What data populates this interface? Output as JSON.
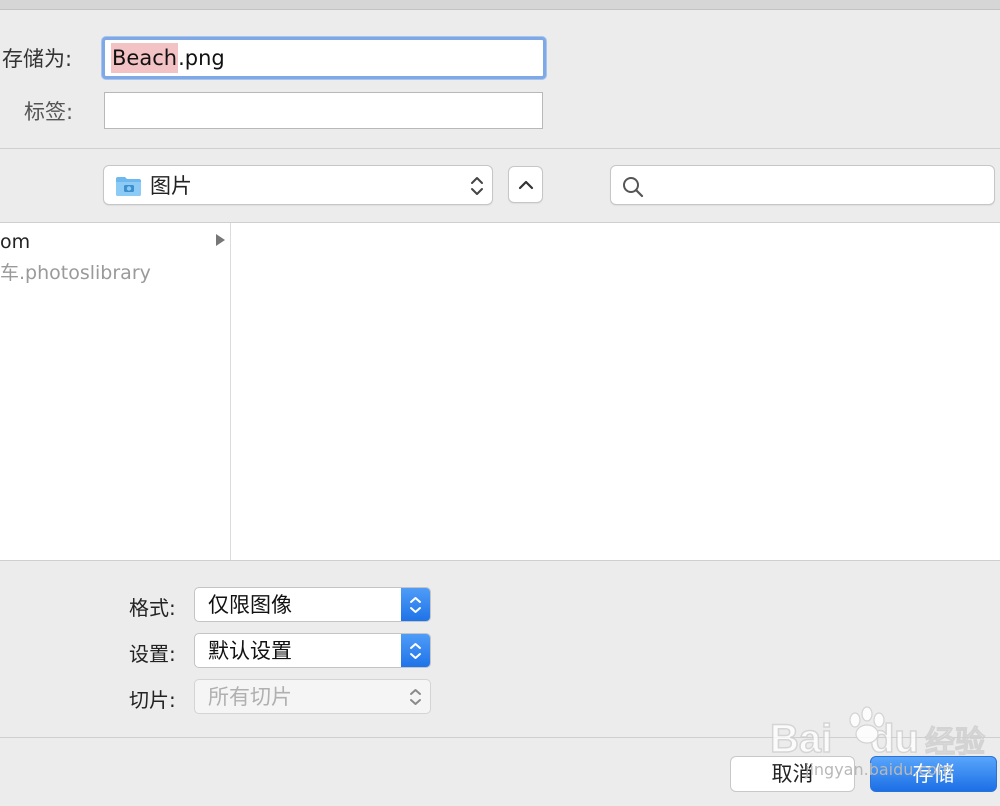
{
  "form": {
    "save_as_label": "存储为:",
    "filename_selected": "Beach",
    "filename_extension": ".png",
    "tags_label": "标签:",
    "tags_value": ""
  },
  "navigation": {
    "location_label": "图片",
    "search_value": ""
  },
  "browser": {
    "items": [
      {
        "label": "om",
        "has_children": true
      },
      {
        "label": "车.photoslibrary",
        "has_children": false
      }
    ]
  },
  "options": {
    "format_label": "格式:",
    "format_value": "仅限图像",
    "settings_label": "设置:",
    "settings_value": "默认设置",
    "slices_label": "切片:",
    "slices_value": "所有切片"
  },
  "buttons": {
    "cancel_label": "取消",
    "save_label": "存储"
  },
  "watermark": {
    "text": "jingyan.baidu.com"
  },
  "colors": {
    "accent": "#1e73e8",
    "selection": "#f3c2c5",
    "focus_ring": "#7fa9e6"
  }
}
